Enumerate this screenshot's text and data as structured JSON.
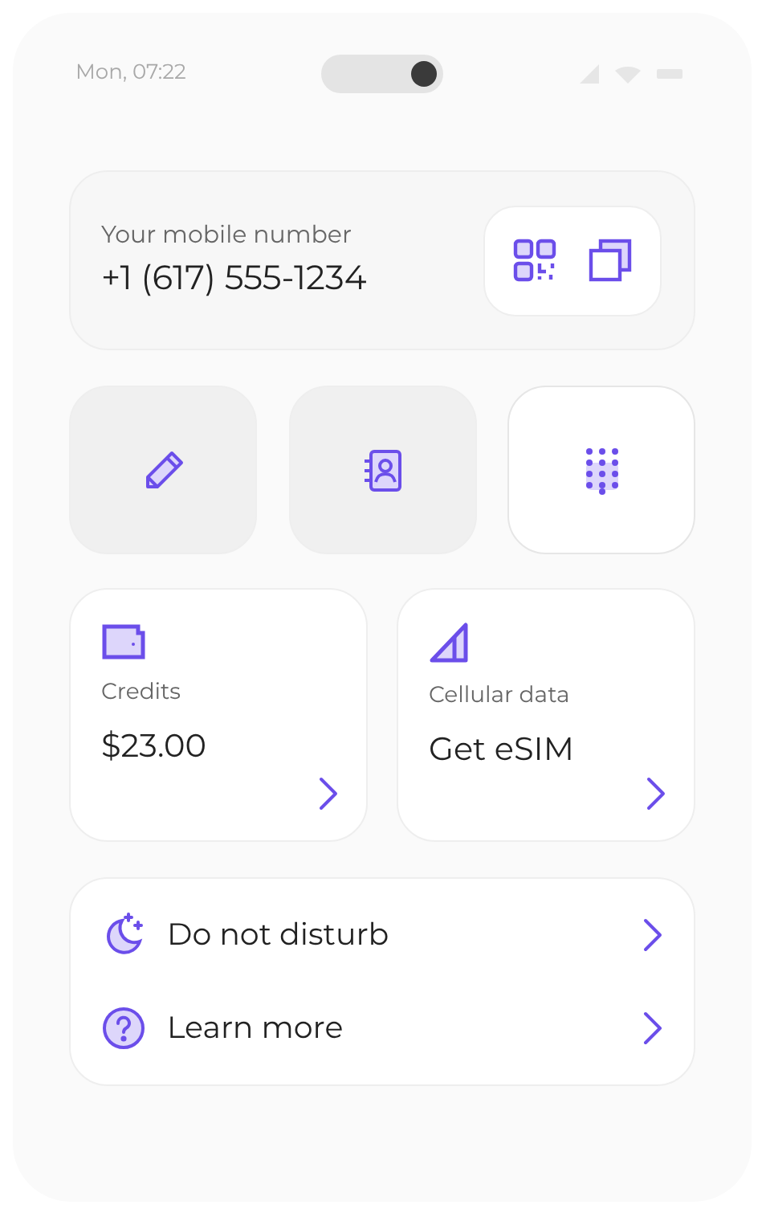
{
  "status_bar": {
    "time": "Mon, 07:22"
  },
  "number_card": {
    "label": "Your mobile number",
    "number": "+1 (617) 555-1234"
  },
  "actions": [
    {
      "kind": "edit",
      "selected": false
    },
    {
      "kind": "contacts",
      "selected": false
    },
    {
      "kind": "keypad",
      "selected": true
    }
  ],
  "cards": [
    {
      "kind": "wallet",
      "label": "Credits",
      "value": "$23.00"
    },
    {
      "kind": "signal",
      "label": "Cellular data",
      "value": "Get eSIM"
    }
  ],
  "menu": [
    {
      "kind": "moon",
      "label": "Do not disturb"
    },
    {
      "kind": "help",
      "label": "Learn more"
    }
  ]
}
